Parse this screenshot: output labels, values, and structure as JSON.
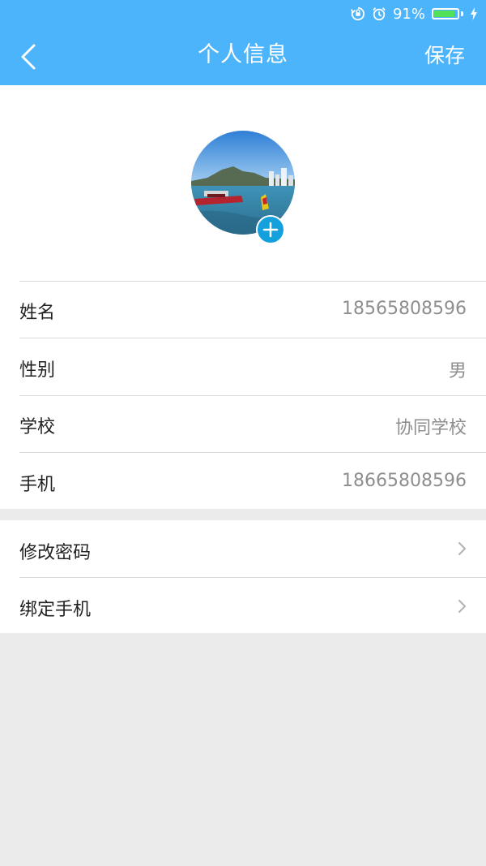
{
  "status_bar": {
    "battery_text": "91%",
    "battery_level": 0.91
  },
  "nav": {
    "title": "个人信息",
    "save_label": "保存"
  },
  "profile": {
    "rows": [
      {
        "label": "姓名",
        "value": "18565808596"
      },
      {
        "label": "性别",
        "value": "男"
      },
      {
        "label": "学校",
        "value": "协同学校"
      },
      {
        "label": "手机",
        "value": "18665808596"
      }
    ]
  },
  "settings": {
    "items": [
      {
        "label": "修改密码"
      },
      {
        "label": "绑定手机"
      }
    ]
  },
  "colors": {
    "header": "#4bb4fb",
    "avatar_add": "#14a0dc",
    "battery": "#52e05a"
  }
}
